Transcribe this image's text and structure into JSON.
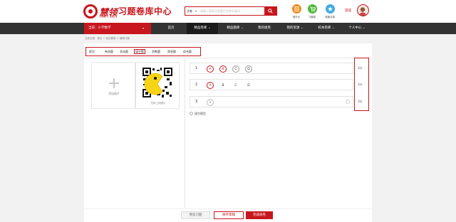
{
  "header": {
    "brand": "慧领",
    "brand_sub": "FAIRLY BAND",
    "title": "习题卷库中心",
    "search": {
      "type_label": "试卷",
      "placeholder": "请输入搜索试卷题目名称关键词"
    },
    "quick_links": [
      {
        "label": "做作业",
        "color": "#f08a1c",
        "icon": "homework-icon"
      },
      {
        "label": "习题卷",
        "color": "#4fb83b",
        "icon": "cart-icon"
      },
      {
        "label": "收藏试卷",
        "color": "#3fa9e5",
        "icon": "favorite-icon"
      }
    ],
    "user_name": "游成"
  },
  "nav": {
    "subject": "当前：小学数学",
    "items": [
      {
        "label": "首页"
      },
      {
        "label": "精品卷库 ⌄"
      },
      {
        "label": "精品题库 ⌄"
      },
      {
        "label": "我的组卷"
      },
      {
        "label": "我的资源 ⌄"
      },
      {
        "label": "校本卷库 ⌄"
      },
      {
        "label": "个人中心 ⌄"
      }
    ]
  },
  "breadcrumb": "当前位置：首页 > 我的题库 > 编辑习题",
  "question_types": {
    "label": "题型：",
    "tabs": [
      "单选题",
      "多选题",
      "填空题",
      "判断题",
      "简答题",
      "综合题"
    ],
    "active_index": 2
  },
  "media": {
    "add_image_label": "添加图片",
    "qr_label": "扫码上传图片"
  },
  "answers": [
    {
      "number": "1",
      "options": [
        "A",
        "B",
        "C",
        "D"
      ],
      "selected": [
        0,
        1
      ],
      "score": "3分"
    },
    {
      "number": "2",
      "options": [
        "A",
        "B",
        "C",
        "D"
      ],
      "selected": [
        0
      ],
      "score": "3分"
    },
    {
      "number": "3",
      "input_value": "1",
      "score": "3分"
    }
  ],
  "fill_toggle_label": "填空模型",
  "actions": {
    "preview": "预览习题",
    "save_draft": "保存草稿",
    "done": "完成组卷"
  },
  "colors": {
    "accent": "#c7161d",
    "nav_bg": "#333333"
  }
}
